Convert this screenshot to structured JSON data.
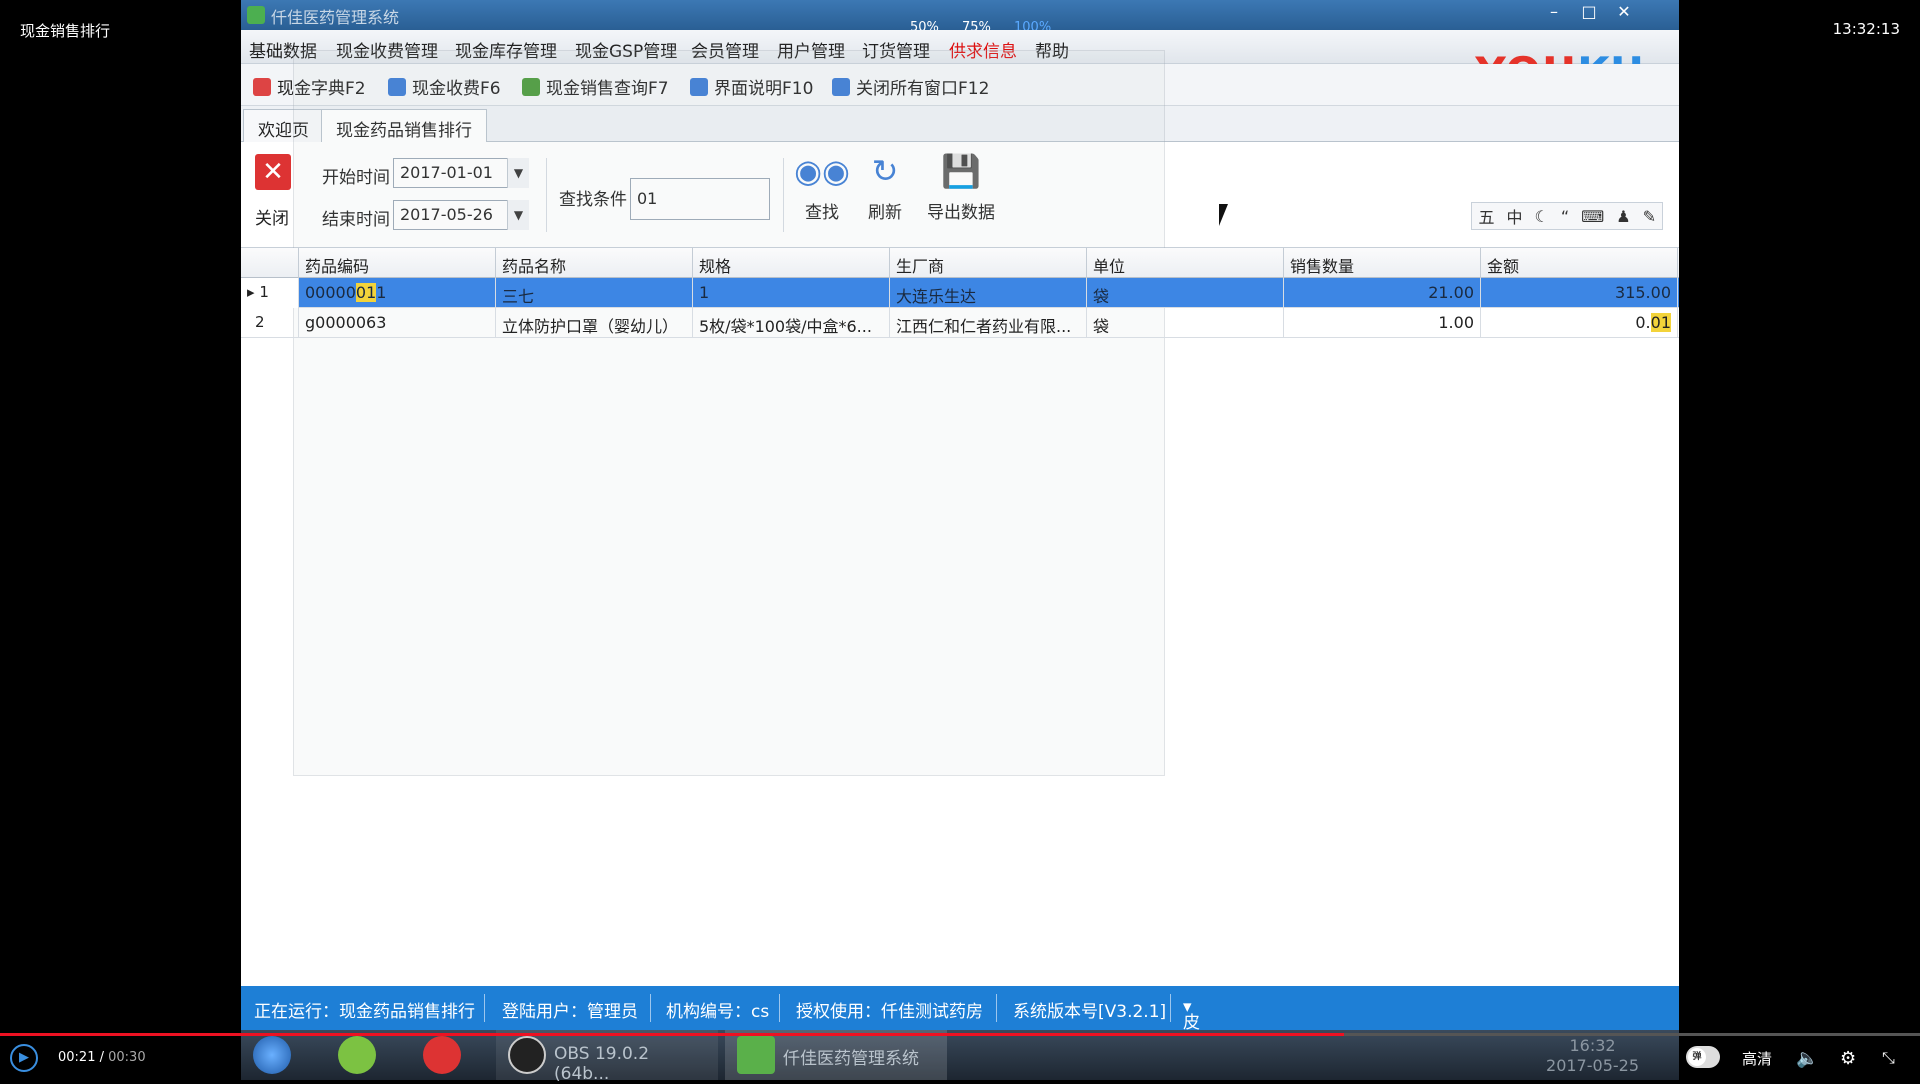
{
  "video": {
    "title": "现金销售排行",
    "clock": "13:32:13",
    "time_current": "00:21",
    "time_total": "00:30",
    "progress": 0.7,
    "quality": "高清",
    "toggle_label": "弹"
  },
  "window": {
    "title": "仟佳医药管理系统",
    "zoom_options": [
      "50%",
      "75%",
      "100%"
    ],
    "zoom_selected": "100%"
  },
  "logo": {
    "part1": "YOU",
    "part2": "KU"
  },
  "menu": [
    "基础数据",
    "现金收费管理",
    "现金库存管理",
    "现金GSP管理",
    "会员管理",
    "用户管理",
    "订货管理",
    "供求信息",
    "帮助"
  ],
  "toolbar": [
    {
      "label": "现金字典F2",
      "icon": "dictionary-icon",
      "color": "#d44"
    },
    {
      "label": "现金收费F6",
      "icon": "money-bag-icon",
      "color": "#3a7bd5"
    },
    {
      "label": "现金销售查询F7",
      "icon": "query-icon",
      "color": "#4a9a3a"
    },
    {
      "label": "界面说明F10",
      "icon": "window-icon",
      "color": "#3a7bd5"
    },
    {
      "label": "关闭所有窗口F12",
      "icon": "close-all-icon",
      "color": "#3a7bd5"
    }
  ],
  "tabs": [
    "欢迎页",
    "现金药品销售排行"
  ],
  "filter": {
    "close_label": "关闭",
    "start_label": "开始时间",
    "start_value": "2017-01-01",
    "end_label": "结束时间",
    "end_value": "2017-05-26",
    "search_label": "查找条件",
    "search_value": "01",
    "buttons": [
      "查找",
      "刷新",
      "导出数据"
    ],
    "mini_tools": [
      "五",
      "中"
    ]
  },
  "grid": {
    "columns": [
      "药品编码",
      "药品名称",
      "规格",
      "生厂商",
      "单位",
      "销售数量",
      "金额"
    ],
    "rows": [
      {
        "n": "1",
        "code_a": "00000",
        "code_b": "01",
        "code_c": "1",
        "name": "三七",
        "spec": "1",
        "maker": "大连乐生达",
        "unit": "袋",
        "qty": "21.00",
        "amount_a": "315.00",
        "amount_b": ""
      },
      {
        "n": "2",
        "code_a": "g0000063",
        "code_b": "",
        "code_c": "",
        "name": "立体防护口罩（婴幼儿）",
        "spec": "5枚/袋*100袋/中盒*6...",
        "maker": "江西仁和仁者药业有限...",
        "unit": "袋",
        "qty": "1.00",
        "amount_a": "0.",
        "amount_b": "01"
      }
    ]
  },
  "status": [
    "正在运行：现金药品销售排行",
    "登陆用户：管理员",
    "机构编号：cs",
    "授权使用：仟佳测试药房",
    "系统版本号[V3.2.1]",
    "皮肤样式"
  ],
  "taskbar": {
    "obs_label": "OBS 19.0.2 (64b...",
    "app_label": "仟佳医药管理系统",
    "time": "16:32",
    "date": "2017-05-25"
  }
}
